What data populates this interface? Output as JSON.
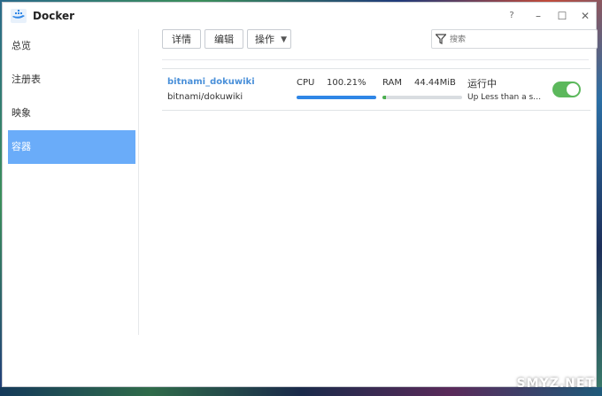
{
  "window": {
    "title": "Docker",
    "controls": {
      "help": "?",
      "minimize": "–",
      "maximize": "☐",
      "close": "✕"
    }
  },
  "sidebar": {
    "items": [
      {
        "label": "总览"
      },
      {
        "label": "注册表"
      },
      {
        "label": "映象"
      },
      {
        "label": "容器",
        "active": true
      }
    ]
  },
  "toolbar": {
    "detail_label": "详情",
    "edit_label": "编辑",
    "action_label": "操作",
    "search_placeholder": "搜索"
  },
  "containers": [
    {
      "name": "bitnami_dokuwiki",
      "image": "bitnami/dokuwiki",
      "cpu_label": "CPU",
      "cpu_value": "100.21%",
      "cpu_fraction": 1.0,
      "ram_label": "RAM",
      "ram_value": "44.44MiB",
      "ram_fraction": 0.04,
      "status": "运行中",
      "status_detail": "Up Less than a sec...",
      "enabled": true
    }
  ],
  "colors": {
    "accent": "#6aacf9",
    "cpu_bar": "#2f86e6",
    "ram_bar": "#4caf50",
    "toggle_on": "#5cb85c",
    "name_link": "#4a90d9"
  },
  "watermark": "SMYZ.NET"
}
